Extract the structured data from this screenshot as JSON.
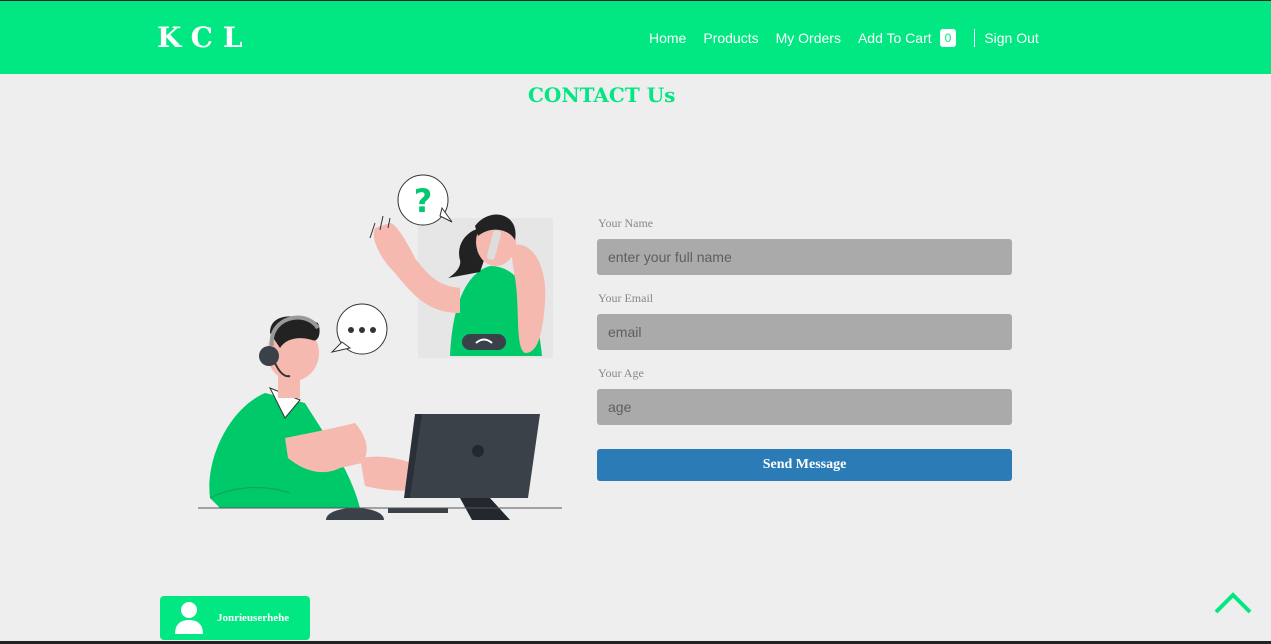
{
  "brand": {
    "logo": "KCL",
    "accent": "#01e882"
  },
  "nav": {
    "home": "Home",
    "products": "Products",
    "my_orders": "My Orders",
    "add_to_cart": "Add To Cart",
    "cart_count": "0",
    "sign_out": "Sign Out"
  },
  "page": {
    "title": "CONTACT Us"
  },
  "form": {
    "name_label": "Your Name",
    "name_placeholder": "enter your full name",
    "email_label": "Your Email",
    "email_placeholder": "email",
    "age_label": "Your Age",
    "age_placeholder": "age",
    "submit_label": "Send Message",
    "submit_color": "#2b7bb7"
  },
  "user": {
    "name": "Jonrieuserhehe",
    "icon": "user-icon"
  },
  "scroll_top": {
    "icon": "chevron-up-icon"
  }
}
